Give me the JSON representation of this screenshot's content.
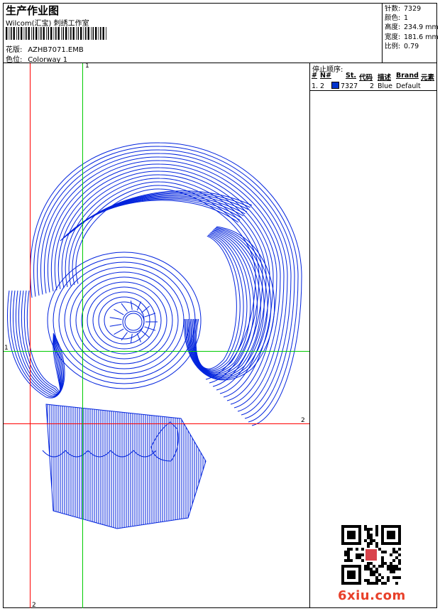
{
  "header": {
    "title": "生产作业图",
    "subtitle": "Wilcom(汇宝) 刺绣工作室",
    "pattern_label": "花版:",
    "pattern_value": "AZHB7071.EMB",
    "colorway_label": "色位:",
    "colorway_value": "Colorway 1"
  },
  "stats": [
    {
      "label": "针数:",
      "value": "7329"
    },
    {
      "label": "颜色:",
      "value": "1"
    },
    {
      "label": "高度:",
      "value": "234.9 mm"
    },
    {
      "label": "宽度:",
      "value": "181.6 mm"
    },
    {
      "label": "比例:",
      "value": "0.79"
    }
  ],
  "stop_sequence": {
    "title": "停止顺序:",
    "headers": [
      "#",
      "N#",
      "St.",
      "代码",
      "描述",
      "Brand",
      "元素"
    ],
    "row": {
      "index": "1.",
      "n": "2",
      "stitches": "7327",
      "code": "2",
      "description": "Blue",
      "brand": "Default",
      "color": "#0033cc"
    }
  },
  "guides": {
    "green_top": "1",
    "green_left": "1",
    "red_right": "2",
    "red_bottom": "2"
  },
  "design": {
    "thread_color": "#0022dd",
    "icon": "skull-embroidery"
  },
  "watermark": "6xiu.com"
}
